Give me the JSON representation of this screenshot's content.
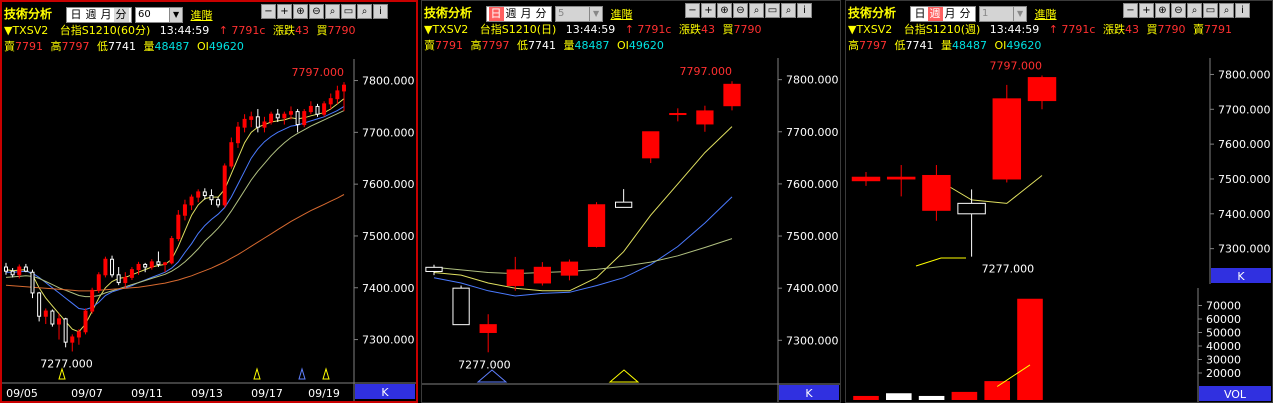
{
  "panels": [
    {
      "title": "技術分析",
      "symbol": "▼TXSV2",
      "name": "台指S1210(60分)",
      "time": "13:44:59",
      "period_opts": [
        "日",
        "週",
        "月",
        "分"
      ],
      "selected_period": "分",
      "interval": "60",
      "advanced": "進階",
      "quote": {
        "up_arrow": "↑",
        "last": "7791c",
        "chg_label": "漲跌",
        "chg": "43",
        "buy_label": "買",
        "buy": "7790",
        "sell_label": "賣",
        "sell": "7791",
        "high_label": "高",
        "high": "7797",
        "low_label": "低",
        "low": "7741",
        "vol_label": "量",
        "vol": "48487",
        "oi_label": "OI",
        "oi": "49620"
      }
    },
    {
      "title": "技術分析",
      "symbol": "▼TXSV2",
      "name": "台指S1210(日)",
      "time": "13:44:59",
      "period_opts": [
        "日",
        "週",
        "月",
        "分"
      ],
      "selected_period": "日",
      "interval": "5",
      "advanced": "進階",
      "quote": {
        "up_arrow": "↑",
        "last": "7791c",
        "chg_label": "漲跌",
        "chg": "43",
        "buy_label": "買",
        "buy": "7790",
        "sell_label": "賣",
        "sell": "7791",
        "high_label": "高",
        "high": "7797",
        "low_label": "低",
        "low": "7741",
        "vol_label": "量",
        "vol": "48487",
        "oi_label": "OI",
        "oi": "49620"
      }
    },
    {
      "title": "技術分析",
      "symbol": "▼TXSV2",
      "name": "台指S1210(週)",
      "time": "13:44:59",
      "period_opts": [
        "日",
        "週",
        "月",
        "分"
      ],
      "selected_period": "週",
      "interval": "1",
      "advanced": "進階",
      "quote": {
        "up_arrow": "↑",
        "last": "7791c",
        "chg_label": "漲跌",
        "chg": "43",
        "buy_label": "買",
        "buy": "7790",
        "sell_label": "賣",
        "sell": "7791",
        "high_label": "高",
        "high": "7797",
        "low_label": "低",
        "low": "7741",
        "vol_label": "量",
        "vol": "48487",
        "oi_label": "OI",
        "oi": "49620"
      }
    }
  ],
  "tool_icons": [
    "minimize-icon",
    "zoom-in-icon",
    "zoom-out-icon",
    "search-icon",
    "link-icon",
    "save-icon",
    "magnify-icon",
    "info-icon"
  ],
  "tool_glyphs": [
    "−",
    "+",
    "⊕",
    "⊖",
    "⌕",
    "▭",
    "⌕",
    "i"
  ],
  "colors": {
    "up": "#ff0000",
    "down": "#ffffff",
    "ma_yellow": "#e0e060",
    "ma_blue": "#4a7aff",
    "ma_green": "#b0c080",
    "ma_orange": "#d86a30",
    "axis_badge": "#3030e0"
  },
  "chart_data": [
    {
      "type": "candlestick",
      "panel": "60分",
      "ylim": [
        7220,
        7830
      ],
      "yticks": [
        7300,
        7400,
        7500,
        7600,
        7700,
        7800
      ],
      "ytick_labels": [
        "7300.000",
        "7400.000",
        "7500.000",
        "7600.000",
        "7700.000",
        "7800.000"
      ],
      "xtick_labels": [
        "09/05",
        "09/07",
        "09/11",
        "09/13",
        "09/17",
        "09/19"
      ],
      "axis_badge": "K",
      "max_label": "7797.000",
      "min_label": "7277.000",
      "candles": [
        [
          7440,
          7448,
          7425,
          7432
        ],
        [
          7432,
          7438,
          7420,
          7425
        ],
        [
          7425,
          7445,
          7418,
          7440
        ],
        [
          7440,
          7446,
          7430,
          7432
        ],
        [
          7430,
          7435,
          7380,
          7390
        ],
        [
          7390,
          7392,
          7335,
          7345
        ],
        [
          7345,
          7360,
          7330,
          7355
        ],
        [
          7355,
          7358,
          7325,
          7330
        ],
        [
          7330,
          7350,
          7300,
          7340
        ],
        [
          7340,
          7342,
          7285,
          7295
        ],
        [
          7295,
          7310,
          7277,
          7305
        ],
        [
          7305,
          7320,
          7290,
          7315
        ],
        [
          7315,
          7360,
          7310,
          7355
        ],
        [
          7355,
          7400,
          7350,
          7395
        ],
        [
          7395,
          7430,
          7390,
          7425
        ],
        [
          7425,
          7460,
          7420,
          7455
        ],
        [
          7455,
          7462,
          7420,
          7425
        ],
        [
          7425,
          7440,
          7405,
          7410
        ],
        [
          7410,
          7430,
          7400,
          7420
        ],
        [
          7420,
          7440,
          7415,
          7435
        ],
        [
          7435,
          7450,
          7425,
          7445
        ],
        [
          7445,
          7448,
          7430,
          7440
        ],
        [
          7440,
          7455,
          7435,
          7450
        ],
        [
          7450,
          7470,
          7440,
          7445
        ],
        [
          7445,
          7450,
          7430,
          7448
        ],
        [
          7448,
          7500,
          7445,
          7495
        ],
        [
          7495,
          7550,
          7490,
          7540
        ],
        [
          7540,
          7570,
          7530,
          7560
        ],
        [
          7560,
          7580,
          7550,
          7575
        ],
        [
          7575,
          7590,
          7565,
          7585
        ],
        [
          7585,
          7592,
          7570,
          7578
        ],
        [
          7578,
          7590,
          7560,
          7570
        ],
        [
          7570,
          7575,
          7555,
          7560
        ],
        [
          7560,
          7640,
          7555,
          7635
        ],
        [
          7635,
          7690,
          7630,
          7680
        ],
        [
          7680,
          7720,
          7670,
          7710
        ],
        [
          7710,
          7735,
          7700,
          7725
        ],
        [
          7725,
          7740,
          7710,
          7730
        ],
        [
          7730,
          7745,
          7700,
          7710
        ],
        [
          7710,
          7730,
          7700,
          7720
        ],
        [
          7720,
          7740,
          7715,
          7735
        ],
        [
          7735,
          7745,
          7720,
          7728
        ],
        [
          7728,
          7740,
          7715,
          7735
        ],
        [
          7735,
          7750,
          7725,
          7740
        ],
        [
          7740,
          7745,
          7700,
          7715
        ],
        [
          7715,
          7745,
          7710,
          7740
        ],
        [
          7740,
          7760,
          7735,
          7750
        ],
        [
          7750,
          7755,
          7730,
          7735
        ],
        [
          7735,
          7760,
          7730,
          7755
        ],
        [
          7755,
          7775,
          7745,
          7765
        ],
        [
          7765,
          7790,
          7755,
          7780
        ],
        [
          7780,
          7797,
          7741,
          7791
        ]
      ],
      "ma": [
        {
          "name": "",
          "color": "#e0e060",
          "values": [
            7435,
            7433,
            7434,
            7435,
            7425,
            7400,
            7380,
            7365,
            7350,
            7335,
            7320,
            7315,
            7330,
            7355,
            7380,
            7400,
            7412,
            7418,
            7420,
            7425,
            7430,
            7435,
            7440,
            7443,
            7445,
            7455,
            7480,
            7510,
            7540,
            7560,
            7572,
            7575,
            7575,
            7590,
            7620,
            7650,
            7680,
            7700,
            7710,
            7715,
            7720,
            7722,
            7724,
            7728,
            7726,
            7728,
            7732,
            7735,
            7738,
            7745,
            7755,
            7765
          ]
        },
        {
          "name": "",
          "color": "#4a7aff",
          "values": [
            7430,
            7430,
            7431,
            7432,
            7428,
            7420,
            7410,
            7400,
            7390,
            7380,
            7370,
            7360,
            7358,
            7362,
            7372,
            7385,
            7392,
            7396,
            7400,
            7404,
            7410,
            7415,
            7420,
            7425,
            7430,
            7438,
            7450,
            7468,
            7485,
            7505,
            7520,
            7532,
            7542,
            7555,
            7575,
            7600,
            7625,
            7650,
            7668,
            7682,
            7692,
            7700,
            7706,
            7712,
            7714,
            7718,
            7722,
            7726,
            7730,
            7736,
            7742,
            7750
          ]
        },
        {
          "name": "",
          "color": "#b0c080",
          "values": [
            7420,
            7421,
            7422,
            7423,
            7422,
            7418,
            7412,
            7406,
            7400,
            7395,
            7390,
            7385,
            7383,
            7383,
            7385,
            7390,
            7394,
            7398,
            7402,
            7406,
            7410,
            7414,
            7418,
            7422,
            7426,
            7432,
            7440,
            7450,
            7462,
            7475,
            7490,
            7502,
            7515,
            7530,
            7548,
            7568,
            7588,
            7608,
            7625,
            7640,
            7655,
            7668,
            7680,
            7690,
            7698,
            7705,
            7712,
            7718,
            7724,
            7730,
            7736,
            7742
          ]
        },
        {
          "name": "",
          "color": "#d86a30",
          "values": [
            7405,
            7404,
            7403,
            7402,
            7401,
            7400,
            7399,
            7398,
            7397,
            7396,
            7395,
            7394,
            7394,
            7394,
            7395,
            7396,
            7397,
            7398,
            7399,
            7400,
            7401,
            7403,
            7405,
            7407,
            7409,
            7412,
            7415,
            7419,
            7423,
            7428,
            7433,
            7438,
            7444,
            7450,
            7457,
            7464,
            7472,
            7480,
            7488,
            7496,
            7504,
            7512,
            7520,
            7528,
            7535,
            7542,
            7549,
            7555,
            7561,
            7567,
            7573,
            7580
          ]
        }
      ]
    },
    {
      "type": "candlestick",
      "panel": "日",
      "ylim": [
        7220,
        7830
      ],
      "yticks": [
        7300,
        7400,
        7500,
        7600,
        7700,
        7800
      ],
      "ytick_labels": [
        "7300.000",
        "7400.000",
        "7500.000",
        "7600.000",
        "7700.000",
        "7800.000"
      ],
      "xtick_labels": [],
      "axis_badge": "K",
      "max_label": "7797.000",
      "min_label": "7277.000",
      "candles": [
        [
          7440,
          7445,
          7425,
          7432
        ],
        [
          7400,
          7405,
          7330,
          7330
        ],
        [
          7315,
          7350,
          7277,
          7330
        ],
        [
          7405,
          7460,
          7395,
          7435
        ],
        [
          7410,
          7450,
          7405,
          7440
        ],
        [
          7425,
          7455,
          7415,
          7450
        ],
        [
          7480,
          7565,
          7478,
          7560
        ],
        [
          7565,
          7590,
          7555,
          7555
        ],
        [
          7650,
          7690,
          7640,
          7700
        ],
        [
          7735,
          7745,
          7720,
          7735
        ],
        [
          7715,
          7750,
          7700,
          7740
        ],
        [
          7750,
          7797,
          7741,
          7791
        ]
      ],
      "ma": [
        {
          "name": "",
          "color": "#e0e060",
          "values": [
            7430,
            7425,
            7410,
            7400,
            7395,
            7395,
            7420,
            7470,
            7540,
            7600,
            7660,
            7710
          ]
        },
        {
          "name": "",
          "color": "#4a7aff",
          "values": [
            7420,
            7410,
            7395,
            7385,
            7390,
            7392,
            7405,
            7420,
            7445,
            7480,
            7525,
            7575
          ]
        },
        {
          "name": "",
          "color": "#b0c080",
          "values": [
            7440,
            7435,
            7430,
            7428,
            7430,
            7432,
            7436,
            7442,
            7450,
            7462,
            7478,
            7495
          ]
        }
      ]
    },
    {
      "type": "candlestick",
      "panel": "週",
      "ylim": [
        7210,
        7830
      ],
      "yticks": [
        7300,
        7400,
        7500,
        7600,
        7700,
        7800
      ],
      "ytick_labels": [
        "7300.000",
        "7400.000",
        "7500.000",
        "7600.000",
        "7700.000",
        "7800.000"
      ],
      "xtick_labels": [],
      "axis_badge": "K",
      "max_label": "7797.000",
      "min_label": "7277.000",
      "candles": [
        [
          7495,
          7520,
          7480,
          7505
        ],
        [
          7500,
          7540,
          7450,
          7505
        ],
        [
          7410,
          7540,
          7380,
          7510
        ],
        [
          7430,
          7470,
          7277,
          7400
        ],
        [
          7500,
          7770,
          7490,
          7730
        ],
        [
          7725,
          7797,
          7700,
          7791
        ]
      ],
      "ma": [
        {
          "name": "",
          "color": "#e0e060",
          "values": [
            null,
            null,
            7500,
            7440,
            7430,
            7510
          ]
        }
      ]
    },
    {
      "type": "bar",
      "panel": "週 volume",
      "ylim": [
        0,
        80000
      ],
      "yticks": [
        20000,
        30000,
        40000,
        50000,
        60000,
        70000
      ],
      "ytick_labels": [
        "20000",
        "30000",
        "40000",
        "50000",
        "60000",
        "70000"
      ],
      "axis_badge": "VOL",
      "values": [
        3000,
        5000,
        3000,
        6000,
        14000,
        75000
      ],
      "ma": [
        null,
        null,
        null,
        null,
        10000,
        26000
      ]
    }
  ]
}
